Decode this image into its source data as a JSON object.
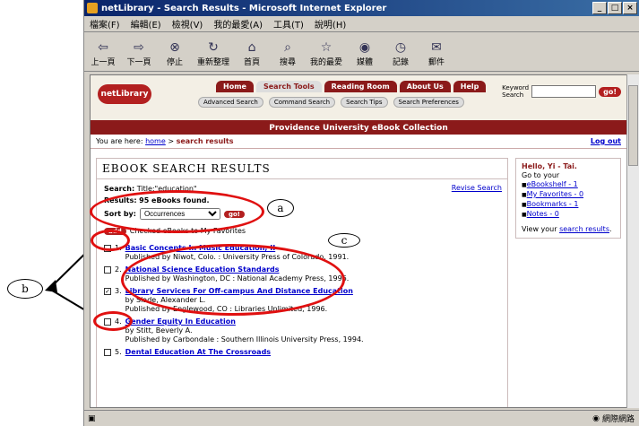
{
  "window": {
    "title": "netLibrary - Search Results - Microsoft Internet Explorer",
    "controls": [
      "_",
      "□",
      "×"
    ]
  },
  "menu": [
    "檔案(F)",
    "編輯(E)",
    "檢視(V)",
    "我的最愛(A)",
    "工具(T)",
    "說明(H)"
  ],
  "toolbar": [
    {
      "label": "上一頁",
      "icon": "back-arrow-icon",
      "glyph": "⇦"
    },
    {
      "label": "下一頁",
      "icon": "forward-arrow-icon",
      "glyph": "⇨"
    },
    {
      "label": "停止",
      "icon": "stop-icon",
      "glyph": "⊗"
    },
    {
      "label": "重新整理",
      "icon": "refresh-icon",
      "glyph": "↻"
    },
    {
      "label": "首頁",
      "icon": "home-icon",
      "glyph": "⌂"
    },
    {
      "label": "搜尋",
      "icon": "search-icon",
      "glyph": "⌕"
    },
    {
      "label": "我的最愛",
      "icon": "favorites-icon",
      "glyph": "☆"
    },
    {
      "label": "媒體",
      "icon": "media-icon",
      "glyph": "◉"
    },
    {
      "label": "記錄",
      "icon": "history-icon",
      "glyph": "◷"
    },
    {
      "label": "郵件",
      "icon": "mail-icon",
      "glyph": "✉"
    }
  ],
  "site": {
    "logo": "netLibrary",
    "tabs": [
      "Home",
      "Search Tools",
      "Reading Room",
      "About Us",
      "Help"
    ],
    "subtabs": [
      "Advanced Search",
      "Command Search",
      "Search Tips",
      "Search Preferences"
    ],
    "keyword_label": "Keyword Search",
    "go": "go!",
    "collection": "Providence University eBook Collection",
    "crumb_prefix": "You are here:",
    "crumb_home": "home",
    "crumb_sep": ">",
    "crumb_current": "search results",
    "logout": "Log out"
  },
  "results": {
    "heading": "EBOOK SEARCH RESULTS",
    "search_label": "Search:",
    "search_value": "Title:\"education\"",
    "count_label": "Results:",
    "count_value": "95 eBooks found.",
    "revise": "Revise Search",
    "sort_label": "Sort by:",
    "sort_value": "Occurrences",
    "sort_go": "go!",
    "add_btn": "add",
    "add_text": "Checked eBooks to My Favorites",
    "items": [
      {
        "num": "1.",
        "title": "Basic Concepts In Music Education, II",
        "author": "",
        "pub": "Published by Niwot, Colo. : University Press of Colorado, 1991.",
        "checked": false
      },
      {
        "num": "2.",
        "title": "National Science Education Standards",
        "author": "",
        "pub": "Published by Washington, DC : National Academy Press, 1996.",
        "checked": false
      },
      {
        "num": "3.",
        "title": "Library Services For Off-campus And Distance Education",
        "author": "by Slade, Alexander L.",
        "pub": "Published by Englewood, CO : Libraries Unlimited, 1996.",
        "checked": true
      },
      {
        "num": "4.",
        "title": "Gender Equity In Education",
        "author": "by Stitt, Beverly A.",
        "pub": "Published by Carbondale : Southern Illinois University Press, 1994.",
        "checked": false
      },
      {
        "num": "5.",
        "title": "Dental Education At The Crossroads",
        "author": "",
        "pub": "",
        "checked": false
      }
    ]
  },
  "side": {
    "hello": "Hello, Yi - Tai.",
    "goto": "Go to your",
    "links": [
      "eBookshelf - 1",
      "My Favorites - 0",
      "Bookmarks - 1",
      "Notes - 0"
    ],
    "view_prefix": "View your",
    "view_link": "search results",
    "view_suffix": "."
  },
  "annotations": {
    "a": "a",
    "b": "b",
    "c": "c"
  },
  "status": {
    "zone": "網際網路"
  }
}
